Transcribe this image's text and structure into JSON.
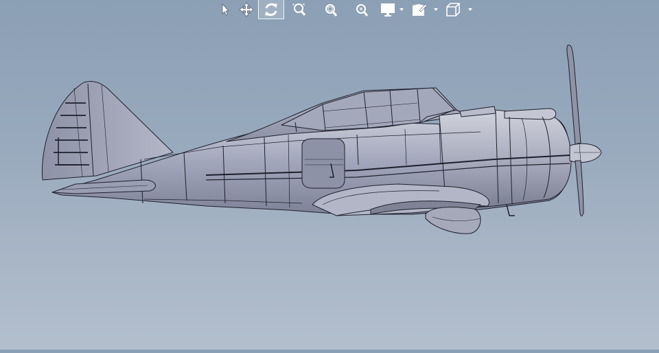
{
  "viewport": {
    "background_top": "#8b9fb5",
    "background_bottom": "#b3bfcd",
    "model_fill": "#9fa4b8",
    "edge_color": "#1c1f2a"
  },
  "toolbar": {
    "active_tool": "rotate",
    "buttons": [
      {
        "name": "select",
        "icon": "pointer-icon",
        "has_dropdown": false
      },
      {
        "name": "pan",
        "icon": "move-arrows-icon",
        "has_dropdown": false
      },
      {
        "name": "rotate",
        "icon": "rotate-icon",
        "has_dropdown": false
      },
      {
        "name": "zoom-to-fit",
        "icon": "zoom-fit-icon",
        "has_dropdown": false
      },
      {
        "name": "zoom-to-area",
        "icon": "zoom-area-icon",
        "has_dropdown": false
      },
      {
        "name": "zoom-in-out",
        "icon": "zoom-icon",
        "has_dropdown": false
      },
      {
        "name": "display-style",
        "icon": "monitor-icon",
        "has_dropdown": true
      },
      {
        "name": "appearance",
        "icon": "edit-appearance-icon",
        "has_dropdown": true
      },
      {
        "name": "view-orientation",
        "icon": "cube-icon",
        "has_dropdown": true
      }
    ]
  },
  "model": {
    "icon": "airplane-model-icon",
    "propeller_blades": 2
  }
}
